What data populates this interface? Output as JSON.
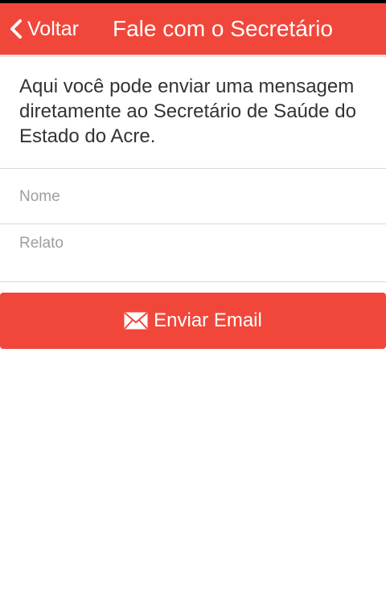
{
  "header": {
    "back_label": "Voltar",
    "back_icon": "chevron-left-icon",
    "title": "Fale com o Secretário"
  },
  "intro": {
    "text": "Aqui você pode enviar uma mensagem diretamente ao Secretário de Saúde do Estado do Acre."
  },
  "form": {
    "name_placeholder": "Nome",
    "name_value": "",
    "report_placeholder": "Relato",
    "report_value": ""
  },
  "send_button": {
    "label": "Enviar Email",
    "icon": "envelope-icon"
  },
  "colors": {
    "accent": "#f1473b",
    "text": "#333333",
    "placeholder": "#9e9e9e",
    "divider": "#d9d9d9"
  }
}
